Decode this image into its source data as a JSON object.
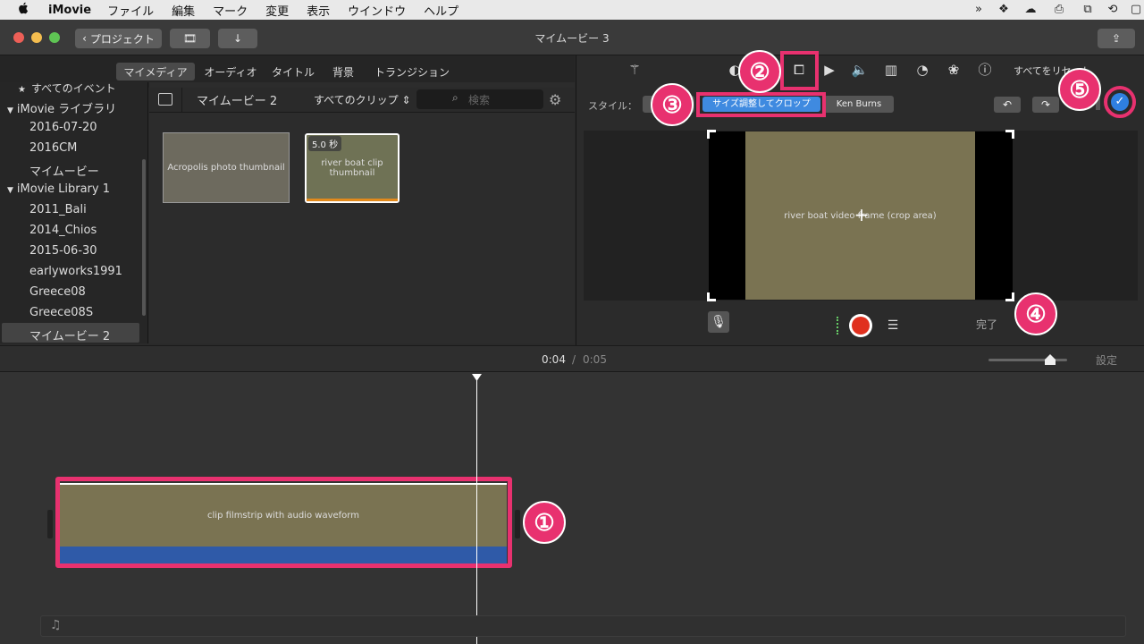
{
  "menubar": {
    "apple": "",
    "app": "iMovie",
    "items": [
      "ファイル",
      "編集",
      "マーク",
      "変更",
      "表示",
      "ウインドウ",
      "ヘルプ"
    ]
  },
  "titlebar": {
    "title": "マイムービー 3",
    "back_label": "プロジェクト"
  },
  "left_tabs": [
    "マイメディア",
    "オーディオ",
    "タイトル",
    "背景",
    "トランジション"
  ],
  "sidebar": {
    "all_events": "すべてのイベント",
    "libraries": [
      {
        "name": "iMovie ライブラリ",
        "items": [
          "2016-07-20",
          "2016CM",
          "マイムービー"
        ]
      },
      {
        "name": "iMovie Library 1",
        "items": [
          "2011_Bali",
          "2014_Chios",
          "2015-06-30",
          "earlyworks1991",
          "Greece08",
          "Greece08S",
          "マイムービー 2"
        ]
      }
    ]
  },
  "browser": {
    "event_title": "マイムービー 2",
    "filter": "すべてのクリップ",
    "search_placeholder": "検索",
    "clip_duration": "5.0 秒",
    "thumb1_label": "Acropolis photo thumbnail",
    "thumb2_label": "river boat clip thumbnail"
  },
  "adjust_bar": {
    "reset_all": "すべてをリセット",
    "style_label": "スタイル：",
    "style_fit": "",
    "style_crop": "サイズ調整してクロップ",
    "style_kenburns": "Ken Burns"
  },
  "viewer": {
    "frame_label": "river boat video frame (crop area)",
    "done": "完了"
  },
  "timeline": {
    "current_time": "0:04",
    "separator": "/",
    "total_time": "0:05",
    "settings": "設定",
    "filmstrip_label": "clip filmstrip with audio waveform"
  },
  "callouts": [
    "①",
    "②",
    "③",
    "④",
    "⑤"
  ],
  "colors": {
    "accent": "#e8316f",
    "record": "#e0301e",
    "selected_style": "#3f8ae0",
    "check": "#2f7fe0",
    "audio_wave": "#2f5aa8"
  }
}
